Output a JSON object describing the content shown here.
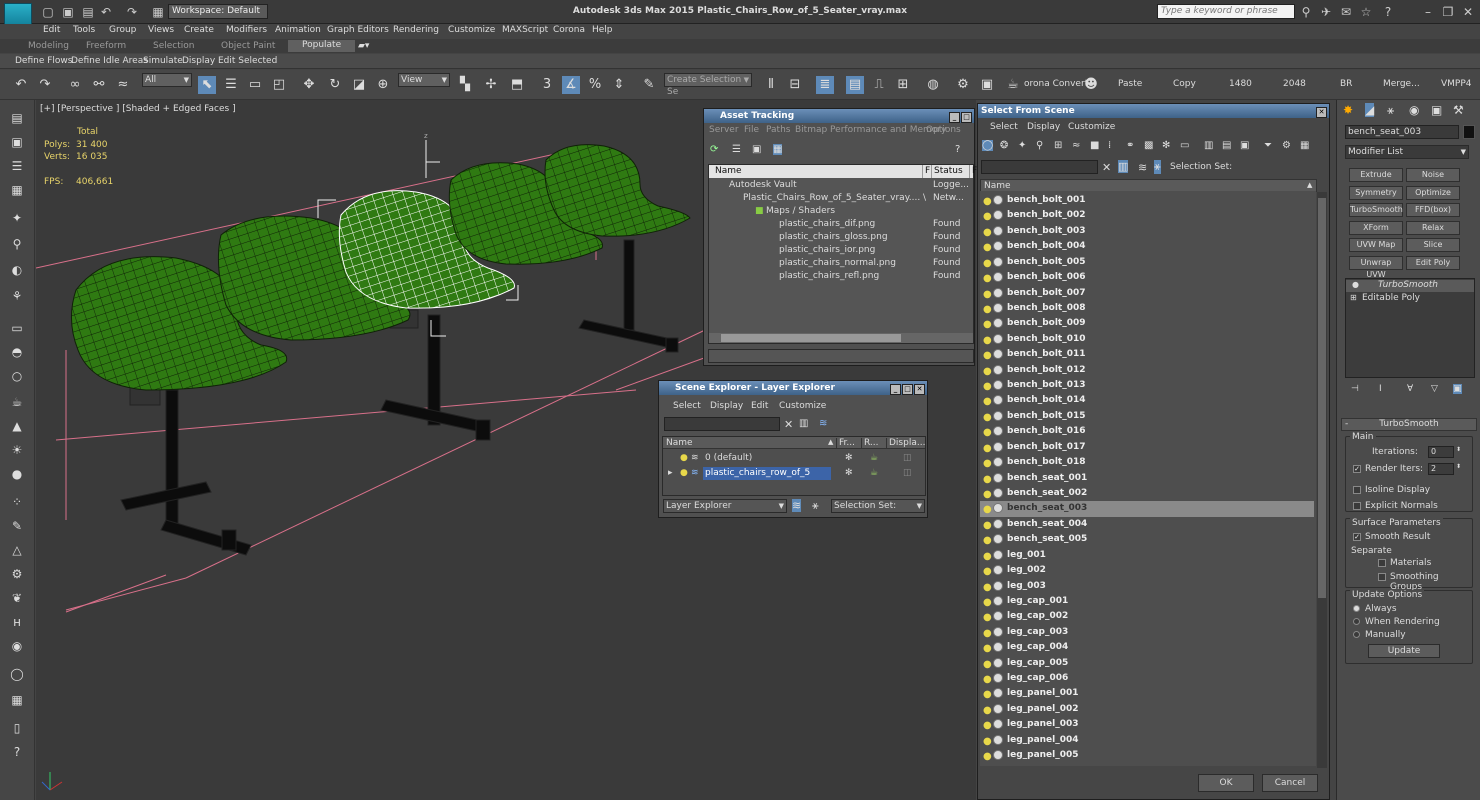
{
  "window": {
    "title": "Autodesk 3ds Max  2015    Plastic_Chairs_Row_of_5_Seater_vray.max",
    "logo": "MAX",
    "workspace": "Workspace: Default",
    "search_placeholder": "Type a keyword or phrase"
  },
  "menu": [
    "Edit",
    "Tools",
    "Group",
    "Views",
    "Create",
    "Modifiers",
    "Animation",
    "Graph Editors",
    "Rendering",
    "Customize",
    "MAXScript",
    "Corona",
    "Help"
  ],
  "ribbon_tabs": [
    "Modeling",
    "Freeform",
    "Selection",
    "Object Paint",
    "Populate"
  ],
  "ribbon_active": "Populate",
  "ribbon_items": [
    "Define Flows",
    "Define Idle Areas",
    "Simulate",
    "Display",
    "Edit Selected"
  ],
  "toolbar": {
    "filter": "All",
    "ref_coord": "View",
    "selection_set": "Create Selection Se",
    "corona_convert": "orona Convert",
    "paste": "Paste",
    "copy": "Copy",
    "w": "1480",
    "h": "2048",
    "br": "BR",
    "merge": "Merge...",
    "vmpp": "VMPP4"
  },
  "viewport": {
    "label": "[+] [Perspective ] [Shaded + Edged Faces ]",
    "stats_total": "Total",
    "polys_label": "Polys:",
    "polys": "31 400",
    "verts_label": "Verts:",
    "verts": "16 035",
    "fps_label": "FPS:",
    "fps": "406,661",
    "axis_z": "z"
  },
  "asset_tracking": {
    "title": "Asset Tracking",
    "menu": [
      "Server",
      "File",
      "Paths",
      "Bitmap Performance and Memory",
      "Options"
    ],
    "columns": [
      "Name",
      "F",
      "Status",
      "F"
    ],
    "rows": [
      {
        "name": "Autodesk Vault",
        "f": "",
        "status": "Logge..."
      },
      {
        "name": "Plastic_Chairs_Row_of_5_Seater_vray....",
        "f": "\\",
        "status": "Netw..."
      },
      {
        "name": "Maps / Shaders",
        "f": "",
        "status": ""
      },
      {
        "name": "plastic_chairs_dif.png",
        "f": "",
        "status": "Found"
      },
      {
        "name": "plastic_chairs_gloss.png",
        "f": "",
        "status": "Found"
      },
      {
        "name": "plastic_chairs_ior.png",
        "f": "",
        "status": "Found"
      },
      {
        "name": "plastic_chairs_normal.png",
        "f": "",
        "status": "Found"
      },
      {
        "name": "plastic_chairs_refl.png",
        "f": "",
        "status": "Found"
      }
    ]
  },
  "scene_explorer": {
    "title": "Scene Explorer - Layer Explorer",
    "menu": [
      "Select",
      "Display",
      "Edit",
      "Customize"
    ],
    "columns": [
      "Name",
      "Fr...",
      "R...",
      "Displa..."
    ],
    "layers": [
      "0 (default)",
      "plastic_chairs_row_of_5"
    ],
    "footer_drop": "Layer Explorer",
    "selection_set": "Selection Set:"
  },
  "select_from_scene": {
    "title": "Select From Scene",
    "menu": [
      "Select",
      "Display",
      "Customize"
    ],
    "selection_set": "Selection Set:",
    "column": "Name",
    "items": [
      "bench_bolt_001",
      "bench_bolt_002",
      "bench_bolt_003",
      "bench_bolt_004",
      "bench_bolt_005",
      "bench_bolt_006",
      "bench_bolt_007",
      "bench_bolt_008",
      "bench_bolt_009",
      "bench_bolt_010",
      "bench_bolt_011",
      "bench_bolt_012",
      "bench_bolt_013",
      "bench_bolt_014",
      "bench_bolt_015",
      "bench_bolt_016",
      "bench_bolt_017",
      "bench_bolt_018",
      "bench_seat_001",
      "bench_seat_002",
      "bench_seat_003",
      "bench_seat_004",
      "bench_seat_005",
      "leg_001",
      "leg_002",
      "leg_003",
      "leg_cap_001",
      "leg_cap_002",
      "leg_cap_003",
      "leg_cap_004",
      "leg_cap_005",
      "leg_cap_006",
      "leg_panel_001",
      "leg_panel_002",
      "leg_panel_003",
      "leg_panel_004",
      "leg_panel_005"
    ],
    "selected": "bench_seat_003",
    "ok": "OK",
    "cancel": "Cancel"
  },
  "command_panel": {
    "object_name": "bench_seat_003",
    "modifier_list": "Modifier List",
    "buttons": [
      [
        "Extrude",
        "Noise"
      ],
      [
        "Symmetry",
        "Optimize"
      ],
      [
        "TurboSmooth",
        "FFD(box)"
      ],
      [
        "XForm",
        "Relax"
      ],
      [
        "UVW Map",
        "Slice"
      ],
      [
        "Unwrap UVW",
        "Edit Poly"
      ]
    ],
    "stack": [
      "TurboSmooth",
      "Editable Poly"
    ],
    "rollout": "TurboSmooth",
    "main_group": "Main",
    "iterations_label": "Iterations:",
    "iterations": "0",
    "render_iters_label": "Render Iters:",
    "render_iters": "2",
    "isoline": "Isoline Display",
    "explicit": "Explicit Normals",
    "surface_group": "Surface Parameters",
    "smooth_result": "Smooth Result",
    "separate": "Separate",
    "materials": "Materials",
    "smoothing_groups": "Smoothing Groups",
    "update_group": "Update Options",
    "always": "Always",
    "when_rendering": "When Rendering",
    "manually": "Manually",
    "update": "Update"
  },
  "colors": {
    "accent": "#3e6288",
    "mesh": "#2f7a12",
    "wire": "#101f08",
    "bbox": "#d8708a"
  }
}
